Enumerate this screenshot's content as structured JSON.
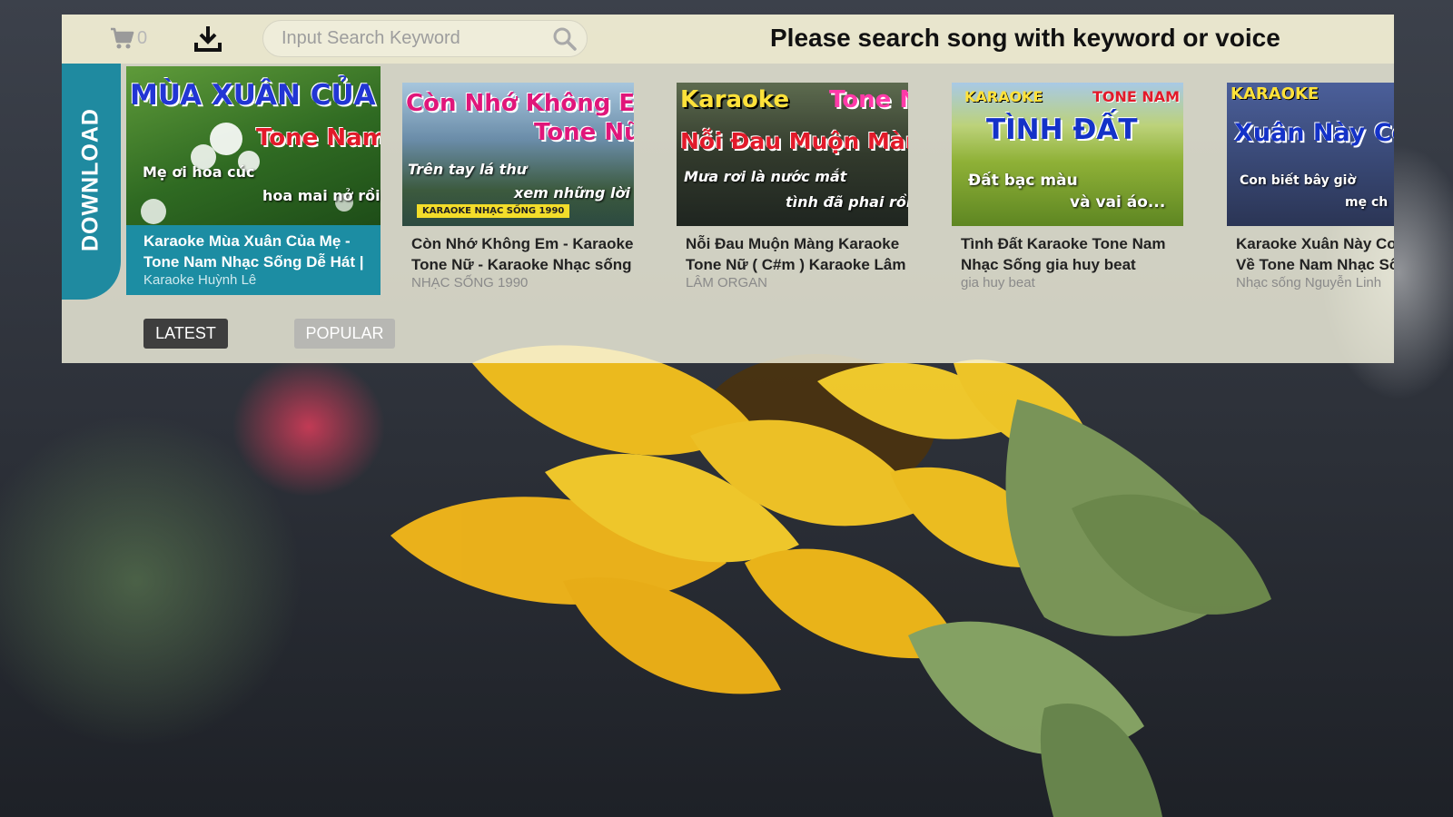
{
  "colors": {
    "accent": "#1f8aa0",
    "panel_bg": "#f8f6e2",
    "tab_active": "#3e3e3e",
    "tab_inactive": "#b7b7b3"
  },
  "header": {
    "cart_icon": "cart-icon",
    "cart_count": "0",
    "download_icon": "download-icon",
    "search_placeholder": "Input Search Keyword",
    "search_value": "",
    "search_icon": "search-icon",
    "hint": "Please search song with keyword or voice"
  },
  "sidebar": {
    "download_label": "DOWNLOAD"
  },
  "songs": [
    {
      "thumb": {
        "line1": "MÙA XUÂN CỦA MẸ",
        "line2": "Tone Nam",
        "line3": "Mẹ ơi hoa cúc",
        "line4": "hoa mai nở rồi",
        "bg": "#3f7f2c",
        "c1": "#2236d4",
        "c2": "#e21a2a"
      },
      "title": "Karaoke Mùa Xuân Của Mẹ - Tone Nam Nhạc Sống Dễ Hát |",
      "channel": "Karaoke Huỳnh Lê"
    },
    {
      "thumb": {
        "line1": "Còn Nhớ Không Em",
        "line2": "Tone Nữ",
        "line3": "Trên tay lá thư",
        "line4": "xem những lời",
        "badge": "KARAOKE NHẠC SỐNG 1990",
        "bg": "#5b7fa0",
        "c1": "#e0167a",
        "c2": "#e0167a"
      },
      "title": "Còn Nhớ Không Em - Karaoke Tone Nữ - Karaoke Nhạc sống",
      "channel": "NHẠC SỐNG 1990"
    },
    {
      "thumb": {
        "line0": "Karaoke",
        "line2": "Tone Nữ",
        "line1": "Nỗi Đau Muộn Màng",
        "line3": "Mưa rơi là nước mắt",
        "line4": "tình đã phai rồi",
        "bg": "#2f3a2a",
        "c1": "#e21a2a",
        "c2": "#ff3aa8"
      },
      "title": "Nỗi Đau Muộn Màng Karaoke Tone Nữ ( C#m ) Karaoke Lâm",
      "channel": "LÂM ORGAN"
    },
    {
      "thumb": {
        "line0": "KARAOKE",
        "line2": "TONE NAM",
        "line1": "TÌNH ĐẤT",
        "line3": "Đất bạc màu",
        "line4": "và vai áo...",
        "bg": "#7ea23a",
        "c1": "#1432c8",
        "c2": "#e21a2a"
      },
      "title": "Tình Đất Karaoke Tone Nam Nhạc Sống gia huy beat",
      "channel": "gia huy beat"
    },
    {
      "thumb": {
        "line0": "KARAOKE",
        "line1": "Xuân Này Con Kh",
        "line3": "Con biết bây giờ",
        "line4": "mẹ ch",
        "bg": "#3a4a78",
        "c1": "#ffe23a",
        "c2": "#e21a2a"
      },
      "title": "Karaoke Xuân Này Con Không Về Tone Nam Nhạc Sống",
      "channel": "Nhạc sống Nguyễn Linh"
    }
  ],
  "tabs": {
    "latest": "LATEST",
    "popular": "POPULAR"
  }
}
